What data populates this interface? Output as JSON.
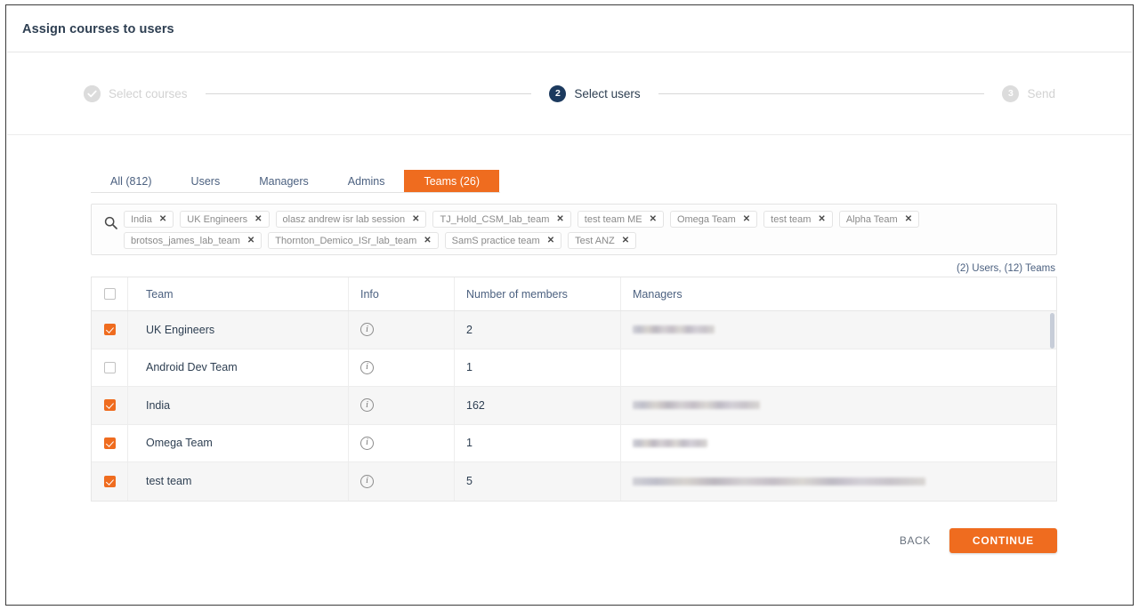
{
  "header": {
    "title": "Assign courses to users"
  },
  "stepper": {
    "steps": [
      {
        "num": "1",
        "label": "Select courses",
        "state": "done"
      },
      {
        "num": "2",
        "label": "Select users",
        "state": "active"
      },
      {
        "num": "3",
        "label": "Send",
        "state": "todo"
      }
    ]
  },
  "tabs": [
    {
      "label": "All (812)",
      "active": false
    },
    {
      "label": "Users",
      "active": false
    },
    {
      "label": "Managers",
      "active": false
    },
    {
      "label": "Admins",
      "active": false
    },
    {
      "label": "Teams (26)",
      "active": true
    }
  ],
  "search": {
    "icon": "search-icon",
    "chips": [
      "India",
      "UK Engineers",
      "olasz andrew isr lab session",
      "TJ_Hold_CSM_lab_team",
      "test team ME",
      "Omega Team",
      "test team",
      "Alpha Team",
      "brotsos_james_lab_team",
      "Thornton_Demico_ISr_lab_team",
      "SamS practice team",
      "Test ANZ"
    ],
    "chip_remove_glyph": "✕"
  },
  "counts": "(2) Users, (12) Teams",
  "table": {
    "columns": [
      "Team",
      "Info",
      "Number of members",
      "Managers"
    ],
    "header_checkbox_checked": false,
    "info_glyph": "i",
    "rows": [
      {
        "checked": true,
        "team": "UK Engineers",
        "members": "2",
        "managers_redacted_width": 92
      },
      {
        "checked": false,
        "team": "Android Dev Team",
        "members": "1",
        "managers_redacted_width": 0
      },
      {
        "checked": true,
        "team": "India",
        "members": "162",
        "managers_redacted_width": 143
      },
      {
        "checked": true,
        "team": "Omega Team",
        "members": "1",
        "managers_redacted_width": 84
      },
      {
        "checked": true,
        "team": "test team",
        "members": "5",
        "managers_redacted_width": 329
      }
    ]
  },
  "footer": {
    "back_label": "BACK",
    "continue_label": "CONTINUE"
  },
  "colors": {
    "accent": "#ef6c1f",
    "step_active": "#1c3a5e",
    "text": "#2e3f52",
    "muted": "#4c6180"
  }
}
